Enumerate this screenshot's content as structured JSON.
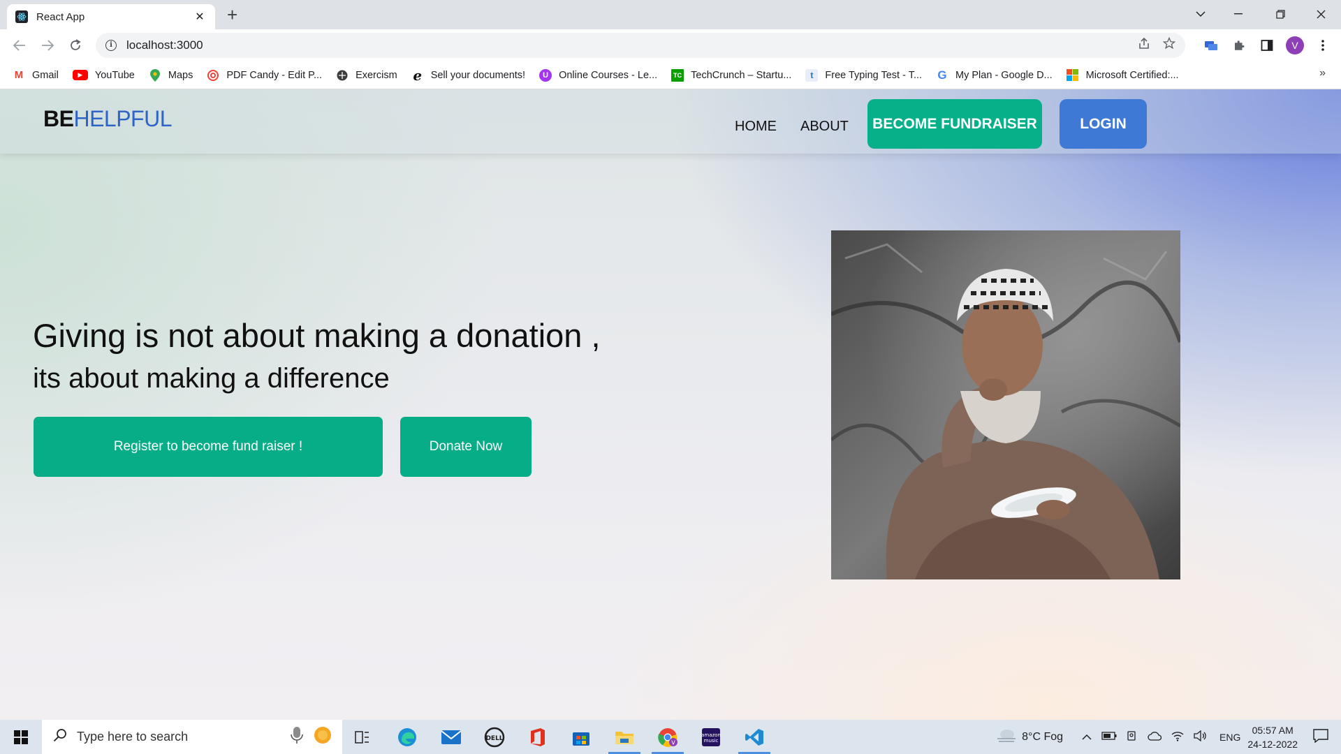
{
  "browser": {
    "tab_title": "React App",
    "tab_close": "✕",
    "new_tab": "+",
    "url": "localhost:3000",
    "profile_initial": "V",
    "bookmarks": [
      {
        "label": "Gmail",
        "icon": "gmail-icon",
        "color": "#ea4335",
        "glyph": "M"
      },
      {
        "label": "YouTube",
        "icon": "youtube-icon",
        "color": "#ff0000",
        "glyph": "▶"
      },
      {
        "label": "Maps",
        "icon": "maps-icon",
        "color": "#34a853",
        "glyph": "◆"
      },
      {
        "label": "PDF Candy - Edit P...",
        "icon": "pdf-candy-icon",
        "color": "#ef4136",
        "glyph": "◎"
      },
      {
        "label": "Exercism",
        "icon": "exercism-icon",
        "color": "#3d3d3d",
        "glyph": "⊕"
      },
      {
        "label": "Sell your documents!",
        "icon": "edocs-icon",
        "color": "#111111",
        "glyph": "e"
      },
      {
        "label": "Online Courses - Le...",
        "icon": "udemy-icon",
        "color": "#a435f0",
        "glyph": "U"
      },
      {
        "label": "TechCrunch – Startu...",
        "icon": "techcrunch-icon",
        "color": "#0a9e01",
        "glyph": "TC"
      },
      {
        "label": "Free Typing Test - T...",
        "icon": "typing-test-icon",
        "color": "#3a75c4",
        "glyph": "t"
      },
      {
        "label": "My Plan - Google D...",
        "icon": "google-icon",
        "color": "#4285f4",
        "glyph": "G"
      },
      {
        "label": "Microsoft Certified:...",
        "icon": "microsoft-icon",
        "color": "#f25022",
        "glyph": "▦"
      }
    ],
    "bookmarks_more": "»"
  },
  "site": {
    "logo_be": "BE",
    "logo_helpful": "HELPFUL",
    "nav": {
      "home": "HOME",
      "about": "ABOUT",
      "become_fundraiser": "BECOME FUNDRAISER",
      "login": "LOGIN"
    },
    "hero": {
      "line1": "Giving is not about making a donation ,",
      "line2": "its about making a difference",
      "register_button": "Register to become fund raiser !",
      "donate_button": "Donate Now"
    },
    "colors": {
      "primary_green": "#07ad87",
      "login_blue": "#3f79d6",
      "logo_blue": "#2e63c7"
    }
  },
  "taskbar": {
    "search_placeholder": "Type here to search",
    "weather": "8°C  Fog",
    "language": "ENG",
    "time": "05:57 AM",
    "date": "24-12-2022"
  }
}
